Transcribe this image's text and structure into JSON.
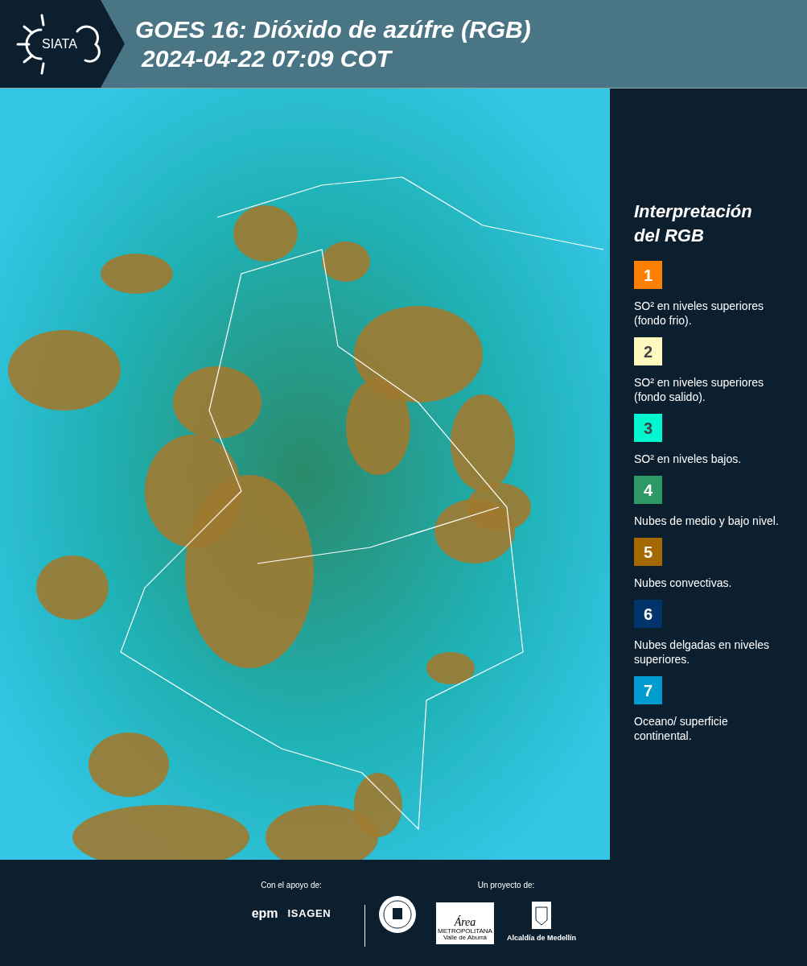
{
  "header": {
    "logo_text": "SIATA",
    "title": "GOES 16: Dióxido de azúfre (RGB)",
    "subtitle": "2024-04-22 07:09 COT"
  },
  "legend": {
    "title": "Interpretación del RGB",
    "items": [
      {
        "number": "1",
        "color": "#ff7f00",
        "text": "SO² en niveles superiores (fondo frio)."
      },
      {
        "number": "2",
        "color": "#fff9c0",
        "text": "SO² en niveles superiores (fondo salido)."
      },
      {
        "number": "3",
        "color": "#00f7d0",
        "text": "SO² en niveles bajos."
      },
      {
        "number": "4",
        "color": "#2e9966",
        "text": "Nubes de medio y bajo nivel."
      },
      {
        "number": "5",
        "color": "#a36800",
        "text": "Nubes convectivas."
      },
      {
        "number": "6",
        "color": "#00346a",
        "text": "Nubes delgadas en niveles superiores."
      },
      {
        "number": "7",
        "color": "#009ccf",
        "text": "Oceano/ superficie continental."
      }
    ]
  },
  "footer": {
    "support_label": "Con el apoyo de:",
    "support_logos": [
      "epm",
      "ISAGEN"
    ],
    "project_label": "Un proyecto de:",
    "area_logo": [
      "Área",
      "METROPOLITANA",
      "Valle de Aburrá"
    ],
    "city_label": "Alcaldía de Medellín"
  }
}
